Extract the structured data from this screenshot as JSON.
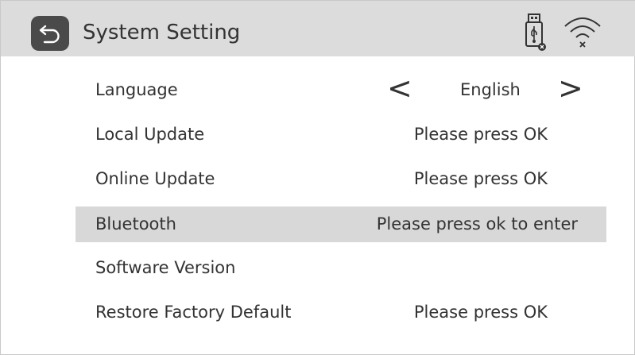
{
  "header": {
    "title": "System Setting",
    "icons": [
      "back-arrow-icon",
      "usb-disconnected-icon",
      "wifi-disconnected-icon"
    ]
  },
  "settings": [
    {
      "label": "Language",
      "value": "English",
      "prev_arrow": "<",
      "next_arrow": ">"
    },
    {
      "label": "Local Update",
      "value": "Please press OK"
    },
    {
      "label": "Online Update",
      "value": "Please press OK"
    },
    {
      "label": "Bluetooth",
      "value": "Please press ok to enter",
      "selected": true
    },
    {
      "label": "Software Version",
      "value": ""
    },
    {
      "label": "Restore Factory Default",
      "value": "Please press OK"
    }
  ],
  "colors": {
    "header_bg": "#dcdcdc",
    "selected_row_bg": "#d8d8d8",
    "back_button_bg": "#4a4a4a",
    "text": "#333333"
  }
}
